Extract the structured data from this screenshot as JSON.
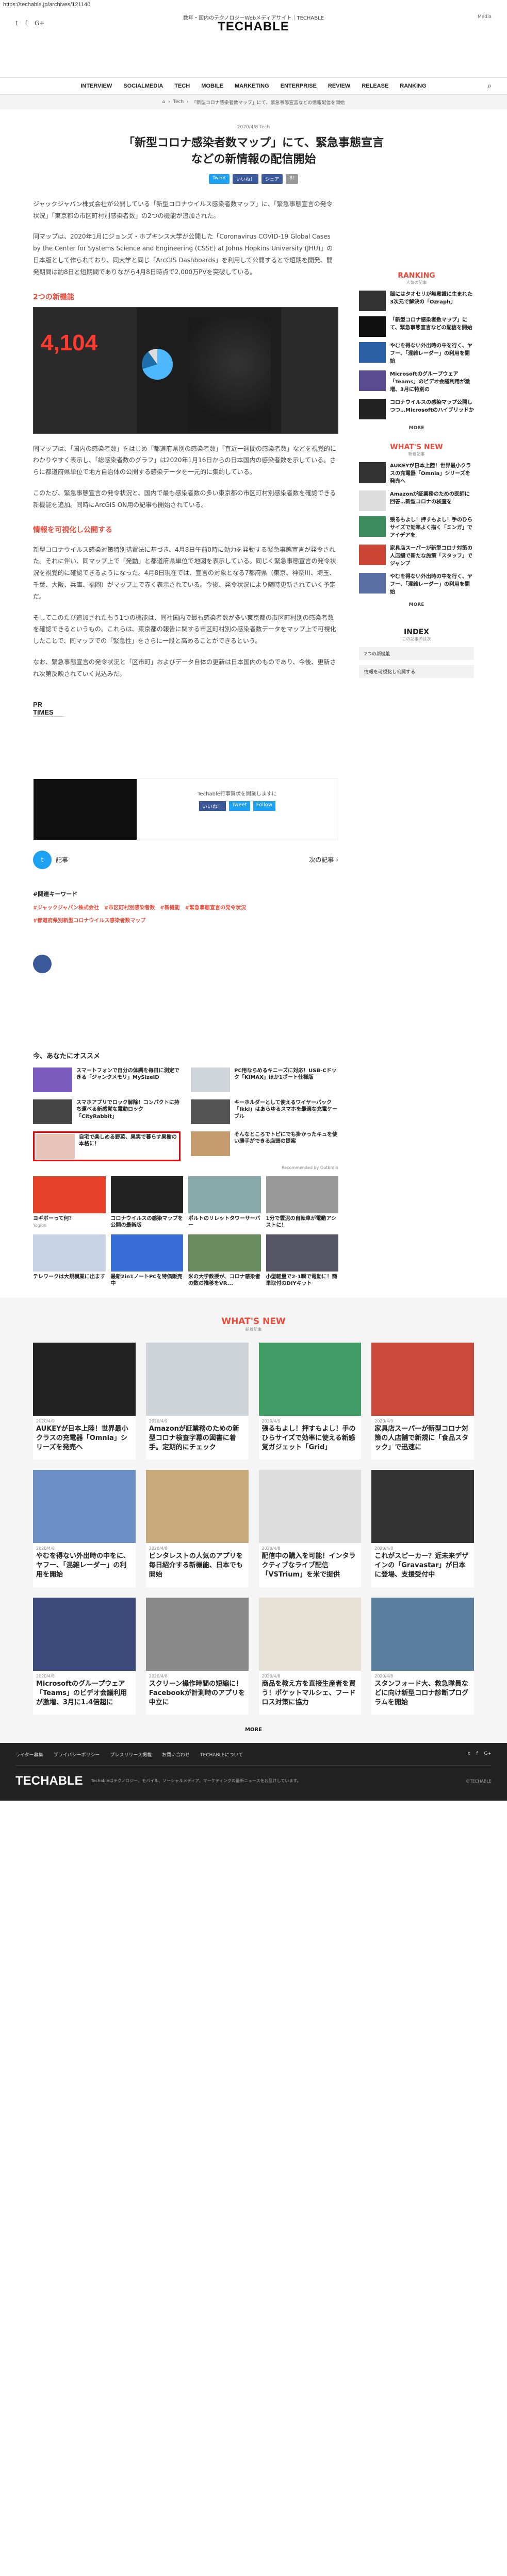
{
  "url": "https://techable.jp/archives/121140",
  "header": {
    "brand_line": "数年・国内のテクノロジーWebメディアサイト｜TECHABLE",
    "logo": "TECHABLE",
    "media_tag": "Media",
    "social": [
      "t",
      "f",
      "G+"
    ]
  },
  "nav": {
    "items": [
      "INTERVIEW",
      "SOCIALMEDIA",
      "TECH",
      "MOBILE",
      "MARKETING",
      "ENTERPRISE",
      "REVIEW",
      "RELEASE",
      "RANKING"
    ],
    "search_icon": "search-icon"
  },
  "breadcrumb": [
    "⌂",
    "Tech",
    "「新型コロナ感染者数マップ」にて、緊急事態宣言などの情報配信を開始"
  ],
  "article": {
    "date": "2020/4/8 Tech",
    "title": "「新型コロナ感染者数マップ」にて、緊急事態宣言などの新情報の配信開始",
    "share": [
      "Tweet",
      "いいね！",
      "シェア",
      "B!"
    ],
    "paragraph1": "ジャックジャパン株式会社が公開している「新型コロナウイルス感染者数マップ」に、「緊急事態宣言の発令状況」「東京都の市区町村別感染者数」の2つの機能が追加された。",
    "paragraph2": "同マップは、2020年1月にジョンズ・ホプキンス大学が公開した「Coronavirus COVID-19 Global Cases by the Center for Systems Science and Engineering (CSSE) at Johns Hopkins University (JHU)」の日本版として作られており、同大学と同じ「ArcGIS Dashboards」を利用して公開するとで短期を開発、開発期間は約8日と短期間でありながら4月8日時点で2,000万PVを突破している。",
    "h2_1": "2つの新機能",
    "dashboard_stat": "4,104",
    "paragraph3": "同マップは、「国内の感染者数」をはじめ「都道府県別の感染者数」「直近一週間の感染者数」などを視覚的にわかりやすく表示し、「総感染者数のグラフ」は2020年1月16日からの日本国内の感染者数を示している。さらに都道府県単位で地方自治体の公開する感染データを一元的に集約している。",
    "paragraph4": "このたび、緊急事態宣言の発令状況と、国内で最も感染者数の多い東京都の市区町村別感染者数を確認できる新機能を追加。同時にArcGIS ON用の記事も開始されている。",
    "h2_2": "情報を可視化し公開する",
    "paragraph5": "新型コロナウイルス感染対策特別措置法に基づき、4月8日午前0時に効力を発動する緊急事態宣言が発令された。それに伴い、同マップ上で「発動」と都道府県単位で地図を表示している。同じく緊急事態宣言の発令状況を視覚的に確認できるようになった。4月8日現在では、宣言の対象となる7都府県（東京、神奈川、埼玉、千葉、大阪、兵庫、福岡）がマップ上で赤く表示されている。今後、発令状況により随時更新されていく予定だ。",
    "paragraph6": "そしてこのたび追加されたもう1つの機能は、同社国内で最も感染者数が多い東京都の市区町村別の感染者数を確認できるというもの。これらは、東京都の報告に関する市区町村別の感染者数データをマップ上で可視化したことで、同マップでの「緊急性」をさらに一段と高めることができるという。",
    "paragraph7": "なお、緊急事態宣言の発令状況と「区市町」およびデータ自体の更新は日本国内のものであり、今後、更新され次第反映されていく見込みだ。",
    "source": "PR TIMES"
  },
  "embed": {
    "text": "Techable行事賀状を開業しますに",
    "buttons": [
      "いいね！",
      "Tweet",
      "Follow"
    ]
  },
  "pager": {
    "prev_label": "記事",
    "next_label": "次の記事 ›"
  },
  "keywords": {
    "heading": "#関連キーワード",
    "items": [
      "#ジャックジャパン株式会社",
      "#市区町村別感染者数",
      "#新機能",
      "#緊急事態宣言の発令状況",
      "#都道府県別新型コロナウイルス感染者数マップ"
    ]
  },
  "recommend": {
    "heading": "今、あなたにオススメ",
    "items": [
      {
        "title": "スマートフォンで自分の体調を毎日に測定できる「ジャンクメモリ」MySizeID"
      },
      {
        "title": "PC用ならめるキニーズに対応！USB-Cドック「KIMAX」ほか1ポート仕様版"
      },
      {
        "title": "スマホアプリでロック解除！コンパクトに持ち運べる新感覚な電動ロック「CityRabbit」"
      },
      {
        "title": "キーホルダーとして使えるワイヤーパック「Ikki」はあらゆるスマホを最適な充電ケーブル"
      },
      {
        "title": "自宅で楽しめる野菜、果実で暮らす果樹の本格に！"
      },
      {
        "title": "そんなところでトピにでも掛かったキュを使い勝手ができる店頭の提案"
      }
    ],
    "brand": "Recommended by Outbrain"
  },
  "thumbgrid": [
    {
      "title": "ヨギボーって何？",
      "src": "Yogibo"
    },
    {
      "title": "コロナウイルスの感染マップを公開の最新版",
      "src": ""
    },
    {
      "title": "ポルトのリレットタワーサーバー",
      "src": ""
    },
    {
      "title": "1分で雲泥の自転車が電動アシストに！",
      "src": ""
    },
    {
      "title": "テレワークは大規模業に出ます",
      "src": ""
    },
    {
      "title": "最新2in1ノートPCを特価販売中",
      "src": ""
    },
    {
      "title": "米の大学教授が、コロナ感染者の数の推移をVR...",
      "src": ""
    },
    {
      "title": "小型軽量で2-1瞬で電動に！簡単取付のDIYキット",
      "src": ""
    }
  ],
  "sidebar": {
    "ranking_heading": "RANKING",
    "ranking_sub": "人気の記事",
    "ranking": [
      {
        "num": "1",
        "title": "脳にはタオセリが無意識に生まれた3次元で解決の「Ozraph」"
      },
      {
        "num": "2",
        "title": "「新型コロナ感染者数マップ」にて、緊急事態宣言などの配信を開始"
      },
      {
        "num": "3",
        "title": "やむを得ない外出時の中を行く、ヤフー、「混雑レーダー」の利用を開始"
      },
      {
        "num": "4",
        "title": "Microsoftのグループウェア「Teams」のビデオ会議利用が激増、3月に特別の"
      },
      {
        "num": "5",
        "title": "コロナウイルスの感染マップ公開しつつ…Microsoftのハイブリッドか"
      }
    ],
    "ranking_more": "MORE",
    "new_heading": "WHAT'S NEW",
    "new_sub": "新着記事",
    "new_items": [
      {
        "title": "AUKEYが日本上陸！世界最小クラスの充電器「Omnia」シリーズを発売へ"
      },
      {
        "title": "Amazonが証業務のための医師に回答…新型コロナの検査を"
      },
      {
        "title": "張るもよし！押すもよし！手のひらサイズで効率よく描く「ミンガ」でアイデアを"
      },
      {
        "title": "家具店スーパーが新型コロナ対策の人店舗で新たな施策「スタッフ」でジャンプ"
      },
      {
        "title": "やむを得ない外出時の中を行く、ヤフー、「混雑レーダー」の利用を開始"
      }
    ],
    "new_more": "MORE",
    "index_heading": "INDEX",
    "index_sub": "この記事の目次",
    "index_items": [
      "2つの新機能",
      "情報を可視化し公開する"
    ]
  },
  "bottom": {
    "heading": "WHAT'S NEW",
    "sub": "新着記事",
    "cards": [
      {
        "date": "2020/4/9",
        "title": "AUKEYが日本上陸！世界最小クラスの充電器「Omnia」シリーズを発売へ"
      },
      {
        "date": "2020/4/9",
        "title": "Amazonが証業務のための新型コロナ検査字幕の図書に着手。定期的にチェック"
      },
      {
        "date": "2020/4/9",
        "title": "張るもよし！押すもよし！手のひらサイズで効率に使える新感覚ガジェット「Grid」"
      },
      {
        "date": "2020/4/9",
        "title": "家具店スーパーが新型コロナ対策の人店舗で新規に「食品スタック」で迅速に"
      },
      {
        "date": "2020/4/8",
        "title": "やむを得ない外出時の中をに、ヤフー、「混雑レーダー」の利用を開始"
      },
      {
        "date": "2020/4/8",
        "title": "ピンタレストの人気のアプリを毎日紹介する新機能、日本でも開始"
      },
      {
        "date": "2020/4/8",
        "title": "配信中の購入を可能！インタラクティブなライブ配信「VSTrium」を米で提供"
      },
      {
        "date": "2020/4/8",
        "title": "これがスピーカー？近未来デザインの「Gravastar」が日本に登場、支援受付中"
      },
      {
        "date": "2020/4/8",
        "title": "Microsoftのグループウェア「Teams」のビデオ会議利用が激増、3月に1.4倍超に"
      },
      {
        "date": "2020/4/8",
        "title": "スクリーン操作時間の短縮に！Facebookが計測時のアプリを中立に"
      },
      {
        "date": "2020/4/8",
        "title": "商品を教え方を直接生産者を買う！ポケットマルシェ、フードロス対策に協力"
      },
      {
        "date": "2020/4/8",
        "title": "スタンフォード大、救急隊員などに向け新型コロナ診断プログラムを開始"
      }
    ],
    "more": "MORE"
  },
  "footer": {
    "links": [
      "ライター募集",
      "プライバシーポリシー",
      "プレスリリース掲載",
      "お問い合わせ",
      "TECHABLEについて"
    ],
    "logo": "TECHABLE",
    "description": "Techableはテクノロジー、モバイル、ソーシャルメディア、マーケティングの最新ニュースをお届けしています。",
    "sub": "©TECHABLE"
  }
}
